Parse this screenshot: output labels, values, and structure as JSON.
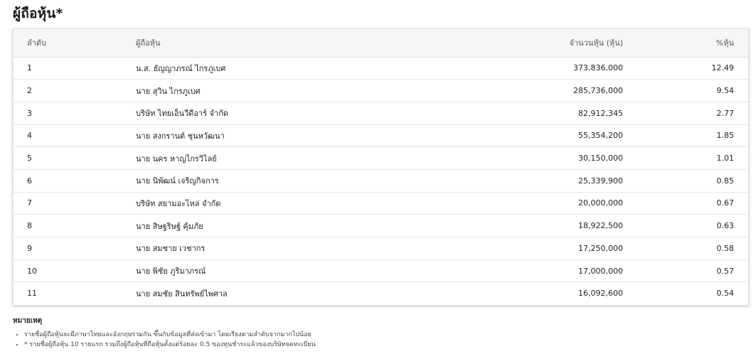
{
  "page": {
    "title": "ผู้ถือหุ้น*"
  },
  "table": {
    "headers": {
      "rank": "ลำดับ",
      "name": "ผู้ถือหุ้น",
      "shares": "จำนวนหุ้น (หุ้น)",
      "pct": "%หุ้น"
    },
    "rows": [
      {
        "rank": "1",
        "name": "น.ส. ธัญญาภรณ์ ไกรภูเบศ",
        "shares": "373,836,000",
        "pct": "12.49"
      },
      {
        "rank": "2",
        "name": "นาย สุวิน ไกรภูเบศ",
        "shares": "285,736,000",
        "pct": "9.54"
      },
      {
        "rank": "3",
        "name": "บริษัท ไทยเอ็นวีดีอาร์ จำกัด",
        "shares": "82,912,345",
        "pct": "2.77"
      },
      {
        "rank": "4",
        "name": "นาย สงกรานต์ ชุนหวัฒนา",
        "shares": "55,354,200",
        "pct": "1.85"
      },
      {
        "rank": "5",
        "name": "นาย นคร หาญไกรวิไลย์",
        "shares": "30,150,000",
        "pct": "1.01"
      },
      {
        "rank": "6",
        "name": "นาย นิพัฒน์ เจริญกิจการ",
        "shares": "25,339,900",
        "pct": "0.85"
      },
      {
        "rank": "7",
        "name": "บริษัท สยามอะไหล่ จำกัด",
        "shares": "20,000,000",
        "pct": "0.67"
      },
      {
        "rank": "8",
        "name": "นาย สิษฐริษฐ์ คุ้มภัย",
        "shares": "18,922,500",
        "pct": "0.63"
      },
      {
        "rank": "9",
        "name": "นาย สมชาย เวชากร",
        "shares": "17,250,000",
        "pct": "0.58"
      },
      {
        "rank": "10",
        "name": "นาย พิชัย ภูริมาภรณ์",
        "shares": "17,000,000",
        "pct": "0.57"
      },
      {
        "rank": "11",
        "name": "นาย สมชัย สินทรัพย์ไพศาล",
        "shares": "16,092,600",
        "pct": "0.54"
      }
    ]
  },
  "notes": {
    "title": "หมายเหตุ",
    "items": [
      "รายชื่อผู้ถือหุ้นจะมีภาษาไทยและอังกฤษรวมกัน ขึ้นกับข้อมูลที่ส่งเข้ามา โดยเรียงตามลำดับจากมากไปน้อย",
      "* รายชื่อผู้ถือหุ้น 10 รายแรก รวมถึงผู้ถือหุ้นที่ถือหุ้นตั้งแต่ร้อยละ 0.5 ของทุนชำระแล้วของบริษัทจดทะเบียน"
    ]
  }
}
